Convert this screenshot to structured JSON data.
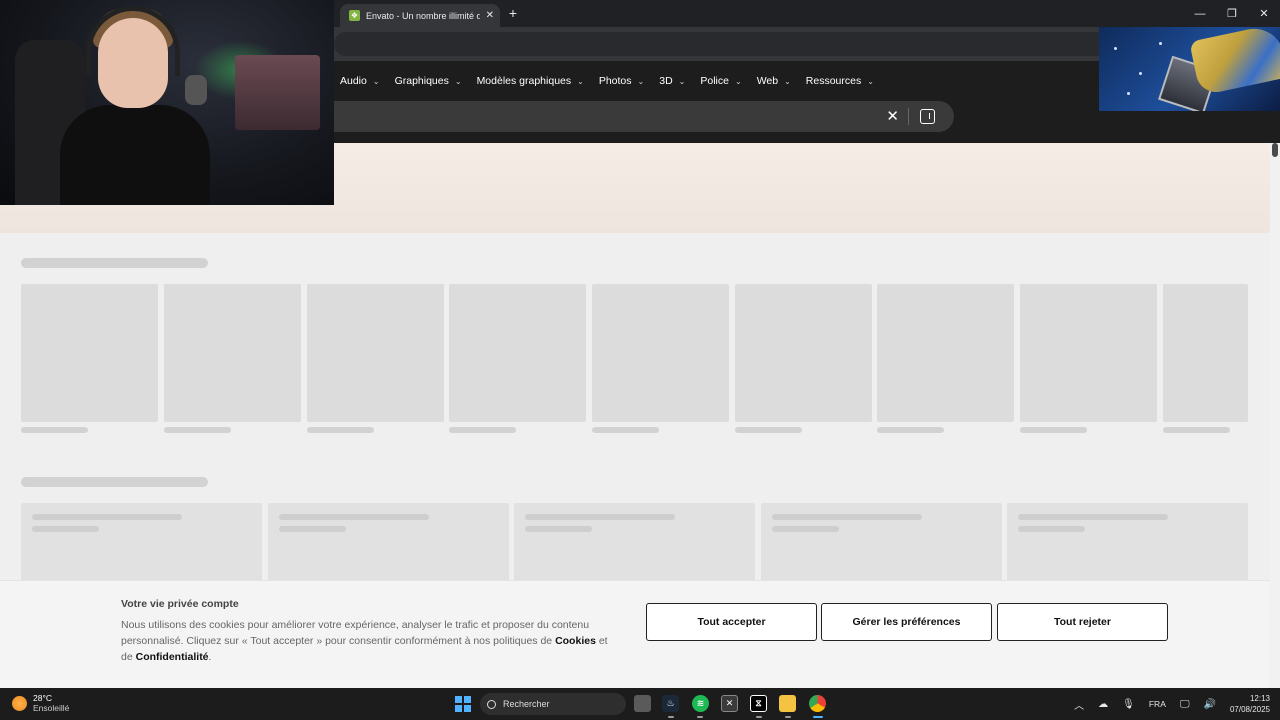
{
  "browser": {
    "tab_title": "Envato - Un nombre illimité d'a",
    "tab_close": "✕",
    "new_tab": "+",
    "window_controls": [
      "—",
      "❐",
      "✕"
    ]
  },
  "envato": {
    "nav": [
      {
        "label": "Audio"
      },
      {
        "label": "Graphiques"
      },
      {
        "label": "Modèles graphiques"
      },
      {
        "label": "Photos"
      },
      {
        "label": "3D"
      },
      {
        "label": "Police"
      },
      {
        "label": "Web"
      },
      {
        "label": "Ressources"
      }
    ],
    "search_clear": "✕"
  },
  "cookie": {
    "title": "Votre vie privée compte",
    "text_main": "Nous utilisons des cookies pour améliorer votre expérience, analyser le trafic et proposer du contenu personnalisé. Cliquez sur « Tout accepter » pour consentir conformément à nos politiques de ",
    "link_cookies": "Cookies",
    "text_and": " et de ",
    "link_privacy": "Confidentialité",
    "text_end": ".",
    "accept": "Tout accepter",
    "manage": "Gérer les préférences",
    "reject": "Tout rejeter"
  },
  "taskbar": {
    "weather_temp": "28°C",
    "weather_cond": "Ensoleillé",
    "search_placeholder": "Rechercher",
    "language": "FRA",
    "time": "12:13",
    "date": "07/08/2025",
    "apps": [
      "task-view",
      "steam",
      "spotify",
      "xbox",
      "capcut",
      "file-explorer",
      "chrome"
    ]
  },
  "colors": {
    "envato_green": "#82b541",
    "header_bg": "#1d1d1d",
    "spotify": "#1db954",
    "start_blue": "#4fb3ff"
  }
}
